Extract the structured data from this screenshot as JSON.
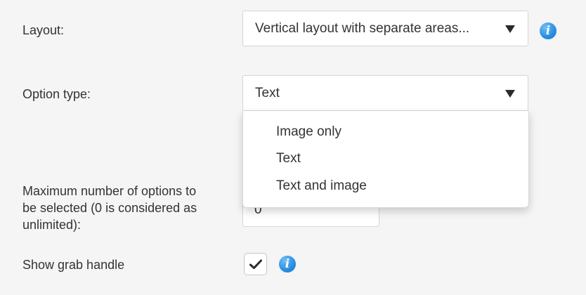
{
  "layout_field": {
    "label": "Layout:",
    "value": "Vertical layout with separate areas...",
    "info_icon": "i"
  },
  "option_type_field": {
    "label": "Option type:",
    "value": "Text",
    "options": [
      "Image only",
      "Text",
      "Text and image"
    ]
  },
  "max_options_field": {
    "label_line1": "Maximum number of options to",
    "label_line2": "be selected (0 is considered as",
    "label_line3": "unlimited):",
    "value": "0"
  },
  "grab_handle_field": {
    "label": "Show grab handle",
    "checked": true,
    "info_icon": "i"
  },
  "colors": {
    "background": "#f5f5f5",
    "info_blue": "#2a8ee0",
    "text": "#333333"
  }
}
